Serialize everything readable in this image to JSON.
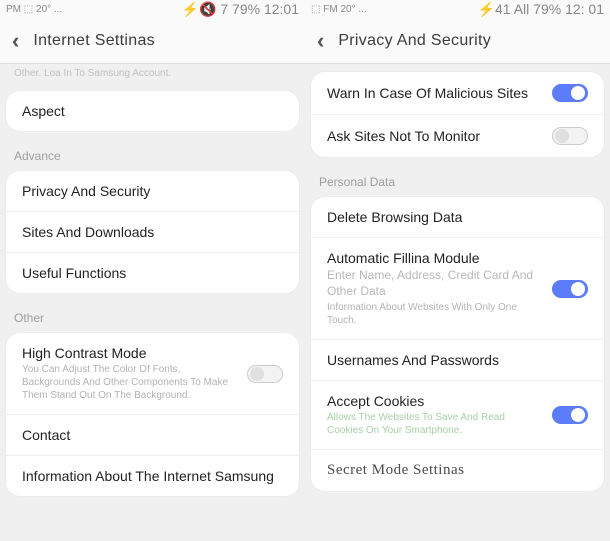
{
  "left": {
    "status": {
      "left": "PM ⬚ 20° ...",
      "right": "⚡🔇 7 79% 12:01"
    },
    "header": {
      "title": "Internet Settinas"
    },
    "banner": "Other. Loa In To Samsung Account.",
    "aspect": "Aspect",
    "advance_label": "Advance",
    "advance_items": {
      "privacy": "Privacy And Security",
      "sites": "Sites And Downloads",
      "useful": "Useful Functions"
    },
    "other_label": "Other",
    "other_items": {
      "contrast_title": "High Contrast Mode",
      "contrast_sub": "You Can Adjust The Color Of Fonts, Backgrounds And Other Components To Make Them Stand Out On The Background.",
      "contact": "Contact",
      "info": "Information About The Internet Samsung"
    }
  },
  "right": {
    "status": {
      "left": "⬚ FM 20° ...",
      "right": "⚡41 All 79% 12: 01"
    },
    "header": {
      "title": "Privacy And Security"
    },
    "warn": "Warn In Case Of Malicious Sites",
    "ask": "Ask Sites Not To Monitor",
    "personal_label": "Personal Data",
    "delete": "Delete Browsing Data",
    "auto_title": "Automatic Fillina Module",
    "auto_sub1": "Enter Name, Address, Credit Card And Other Data",
    "auto_sub2": "Information About Websites With Only One Touch.",
    "usernames": "Usernames And Passwords",
    "cookies_title": "Accept Cookies",
    "cookies_sub": "Allows The Websites To Save And Read Cookies On Your Smartphone.",
    "secret": "Secret Mode Settinas"
  }
}
